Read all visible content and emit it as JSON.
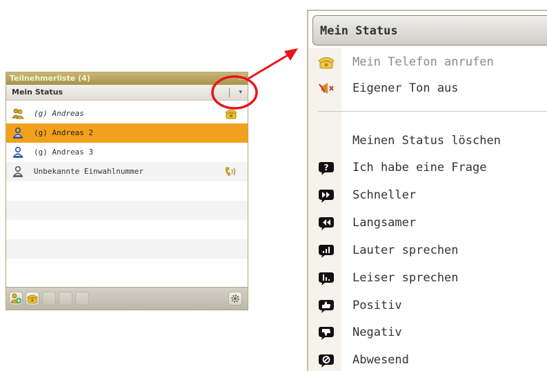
{
  "panel": {
    "title": "Teilnehmerliste (4)",
    "status_label": "Mein Status",
    "dropdown_glyph": "▾",
    "participants": [
      {
        "name": "(g) Andreas",
        "icon": "moderator-icon",
        "italic": true,
        "selected": false,
        "phone": "phone-icon"
      },
      {
        "name": "(g) Andreas 2",
        "icon": "user-icon",
        "italic": false,
        "selected": true,
        "phone": ""
      },
      {
        "name": "(g) Andreas 3",
        "icon": "user-icon",
        "italic": false,
        "selected": false,
        "phone": ""
      },
      {
        "name": "Unbekannte Einwahlnummer",
        "icon": "user-icon",
        "italic": false,
        "selected": false,
        "phone": "phone-ringing-icon"
      }
    ],
    "footer_buttons": [
      "add-user-icon",
      "phone-icon",
      "disabled",
      "disabled",
      "disabled"
    ],
    "settings_icon": "settings-icon"
  },
  "menu": {
    "header": "Mein Status",
    "items": [
      {
        "label": "Mein Telefon anrufen",
        "icon": "telephone-icon",
        "disabled": true
      },
      {
        "label": "Eigener Ton aus",
        "icon": "speaker-mute-icon",
        "disabled": false
      },
      {
        "label": "Meinen Status löschen",
        "icon": "",
        "disabled": false
      },
      {
        "label": "Ich habe eine Frage",
        "icon": "question-icon",
        "disabled": false
      },
      {
        "label": "Schneller",
        "icon": "fast-forward-icon",
        "disabled": false
      },
      {
        "label": "Langsamer",
        "icon": "rewind-icon",
        "disabled": false
      },
      {
        "label": "Lauter sprechen",
        "icon": "volume-up-icon",
        "disabled": false
      },
      {
        "label": "Leiser sprechen",
        "icon": "volume-down-icon",
        "disabled": false
      },
      {
        "label": "Positiv",
        "icon": "thumbs-up-icon",
        "disabled": false
      },
      {
        "label": "Negativ",
        "icon": "thumbs-down-icon",
        "disabled": false
      },
      {
        "label": "Abwesend",
        "icon": "away-icon",
        "disabled": false
      }
    ]
  },
  "colors": {
    "selected_row": "#f1a11c",
    "annotation": "#e8141c",
    "title_bar": "#b39e5c"
  }
}
